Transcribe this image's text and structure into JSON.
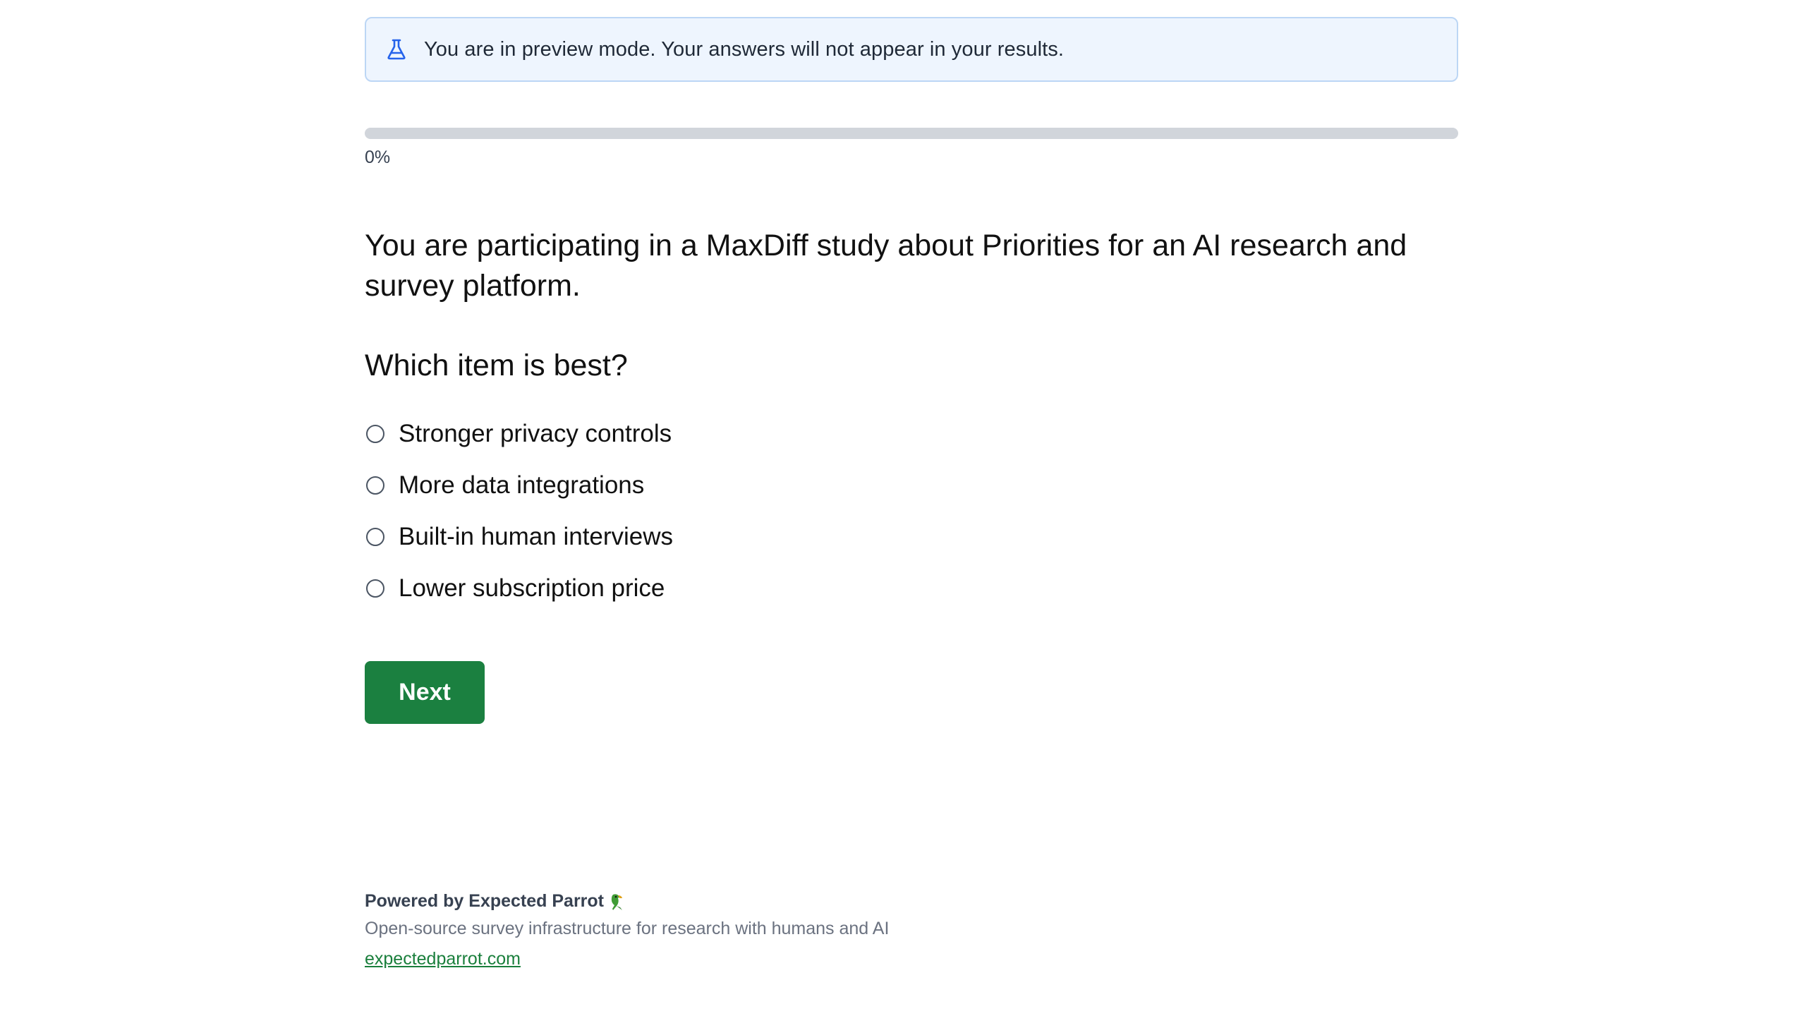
{
  "banner": {
    "icon": "flask-icon",
    "text": "You are in preview mode. Your answers will not appear in your results."
  },
  "progress": {
    "percent": 0,
    "label": "0%"
  },
  "survey": {
    "intro": "You are participating in a MaxDiff study about Priorities for an AI research and survey platform.",
    "question": "Which item is best?",
    "options": [
      {
        "label": "Stronger privacy controls",
        "selected": false
      },
      {
        "label": "More data integrations",
        "selected": false
      },
      {
        "label": "Built-in human interviews",
        "selected": false
      },
      {
        "label": "Lower subscription price",
        "selected": false
      }
    ],
    "next_label": "Next"
  },
  "footer": {
    "powered_by": "Powered by Expected Parrot",
    "parrot_icon": "parrot-icon",
    "tagline": "Open-source survey infrastructure for research with humans and AI",
    "link": "expectedparrot.com"
  },
  "colors": {
    "accent": "#1b8040",
    "banner_bg": "#eef5fe",
    "banner_border": "#bcd6f5",
    "progress_track": "#d1d5db"
  }
}
